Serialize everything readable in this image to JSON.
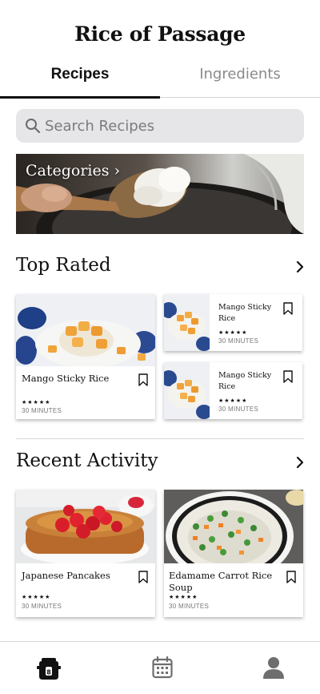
{
  "app": {
    "title": "Rice of Passage"
  },
  "tabs": [
    {
      "label": "Recipes",
      "active": true
    },
    {
      "label": "Ingredients",
      "active": false
    }
  ],
  "search": {
    "placeholder": "Search Recipes",
    "value": ""
  },
  "categories": {
    "label": "Categories"
  },
  "top_rated": {
    "title": "Top Rated",
    "cards": [
      {
        "title": "Mango Sticky Rice",
        "stars": "★★★★★",
        "time": "30 MINUTES"
      },
      {
        "title": "Mango Sticky Rice",
        "stars": "★★★★★",
        "time": "30 MINUTES"
      },
      {
        "title": "Mango Sticky Rice",
        "stars": "★★★★★",
        "time": "30 MINUTES"
      }
    ]
  },
  "recent_activity": {
    "title": "Recent Activity",
    "cards": [
      {
        "title": "Japanese Pancakes",
        "stars": "★★★★★",
        "time": "30 MINUTES"
      },
      {
        "title": "Edamame Carrot Rice Soup",
        "stars": "★★★★★",
        "time": "30 MINUTES"
      }
    ]
  },
  "bottom_nav": {
    "items": [
      {
        "icon": "rice-cooker-icon",
        "active": true
      },
      {
        "icon": "calendar-icon",
        "active": false
      },
      {
        "icon": "profile-icon",
        "active": false
      }
    ]
  },
  "colors": {
    "primary": "#111111",
    "muted": "#8a8a8a",
    "search_bg": "#e6e6e8",
    "nav_icon": "#6e6e6e"
  }
}
